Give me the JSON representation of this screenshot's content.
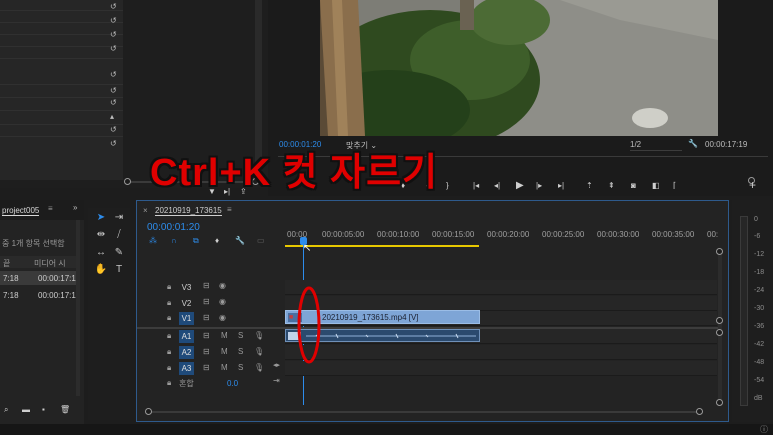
{
  "caption": "Ctrl+K 컷 자르기",
  "effect_controls": {
    "reset_rows": 9
  },
  "monitor": {
    "timecode_left": "00:00:01:20",
    "fit_label": "맞추기",
    "quality": "1/2",
    "timecode_right": "00:00:17:19"
  },
  "project": {
    "tab_label": "project005",
    "info": "중 1개 항목 선택함",
    "col_name": "끝",
    "col_media": "미디어 시",
    "rows": [
      {
        "a": "7:18",
        "b": "00:00:17:1"
      },
      {
        "a": "7:18",
        "b": "00:00:17:1"
      }
    ]
  },
  "timeline": {
    "sequence_name": "20210919_173615",
    "timecode": "00:00:01:20",
    "ruler": [
      "00:00",
      "00:00:05:00",
      "00:00:10:00",
      "00:00:15:00",
      "00:00:20:00",
      "00:00:25:00",
      "00:00:30:00",
      "00:00:35:00",
      "00:"
    ],
    "video_tracks": [
      "V3",
      "V2",
      "V1"
    ],
    "audio_tracks": [
      "A1",
      "A2",
      "A3"
    ],
    "mix_label": "혼합",
    "mix_value": "0.0",
    "clip_label": "20210919_173615.mp4 [V]",
    "track_m": "M",
    "track_s": "S"
  },
  "meter": {
    "db_labels": [
      "0",
      "-6",
      "-12",
      "-18",
      "-24",
      "-30",
      "-36",
      "-42",
      "-48",
      "-54",
      "dB"
    ]
  },
  "colors": {
    "accent": "#2d8ceb",
    "caption": "#e00000",
    "clip": "#7ea5d6",
    "work_bar": "#e8c800"
  }
}
